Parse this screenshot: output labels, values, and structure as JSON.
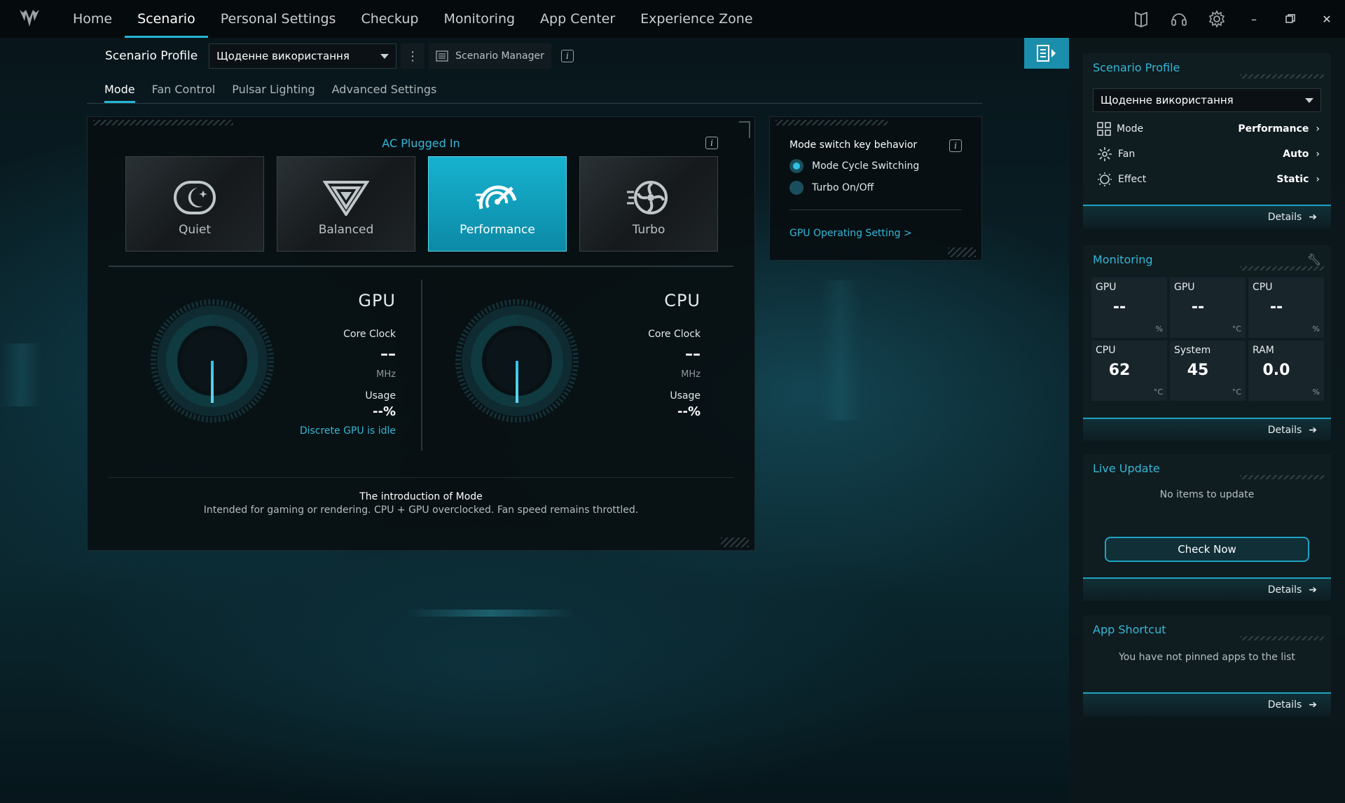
{
  "nav": {
    "items": [
      "Home",
      "Scenario",
      "Personal Settings",
      "Checkup",
      "Monitoring",
      "App Center",
      "Experience Zone"
    ],
    "active": "Scenario"
  },
  "profile": {
    "label": "Scenario Profile",
    "selected": "Щоденне використання",
    "manager_label": "Scenario Manager"
  },
  "subtabs": [
    "Mode",
    "Fan Control",
    "Pulsar Lighting",
    "Advanced Settings"
  ],
  "mode_panel": {
    "power_state": "AC Plugged In",
    "modes": [
      {
        "label": "Quiet",
        "icon": "moon-icon",
        "selected": false
      },
      {
        "label": "Balanced",
        "icon": "triangle-icon",
        "selected": false
      },
      {
        "label": "Performance",
        "icon": "speedometer-icon",
        "selected": true
      },
      {
        "label": "Turbo",
        "icon": "turbo-fan-icon",
        "selected": false
      }
    ],
    "gpu": {
      "title": "GPU",
      "core_clock_label": "Core Clock",
      "core_clock_value": "––",
      "core_clock_unit": "MHz",
      "usage_label": "Usage",
      "usage_value": "--%",
      "status": "Discrete GPU is idle"
    },
    "cpu": {
      "title": "CPU",
      "core_clock_label": "Core Clock",
      "core_clock_value": "––",
      "core_clock_unit": "MHz",
      "usage_label": "Usage",
      "usage_value": "--%"
    },
    "intro_title": "The introduction of Mode",
    "intro_desc": "Intended for gaming or rendering. CPU + GPU overclocked. Fan speed remains throttled."
  },
  "switch_panel": {
    "title": "Mode switch key behavior",
    "options": [
      {
        "label": "Mode Cycle Switching",
        "checked": true
      },
      {
        "label": "Turbo On/Off",
        "checked": false
      }
    ],
    "link": "GPU Operating Setting >"
  },
  "sidebar": {
    "scenario": {
      "title": "Scenario Profile",
      "selected": "Щоденне використання",
      "rows": [
        {
          "label": "Mode",
          "value": "Performance",
          "icon": "mode-grid-icon"
        },
        {
          "label": "Fan",
          "value": "Auto",
          "icon": "fan-icon"
        },
        {
          "label": "Effect",
          "value": "Static",
          "icon": "effect-sun-icon"
        }
      ],
      "details": "Details"
    },
    "monitoring": {
      "title": "Monitoring",
      "cells": [
        {
          "name": "GPU",
          "value": "--",
          "unit": "%"
        },
        {
          "name": "GPU",
          "value": "--",
          "unit": "°C"
        },
        {
          "name": "CPU",
          "value": "--",
          "unit": "%"
        },
        {
          "name": "CPU",
          "value": "62",
          "unit": "°C"
        },
        {
          "name": "System",
          "value": "45",
          "unit": "°C"
        },
        {
          "name": "RAM",
          "value": "0.0",
          "unit": "%"
        }
      ],
      "details": "Details"
    },
    "live_update": {
      "title": "Live Update",
      "empty": "No items to update",
      "button": "Check Now",
      "details": "Details"
    },
    "app_shortcut": {
      "title": "App Shortcut",
      "empty": "You have not pinned apps to the list",
      "details": "Details"
    }
  },
  "colors": {
    "accent": "#25b5d6",
    "selected_mode": "#16b2cf"
  }
}
